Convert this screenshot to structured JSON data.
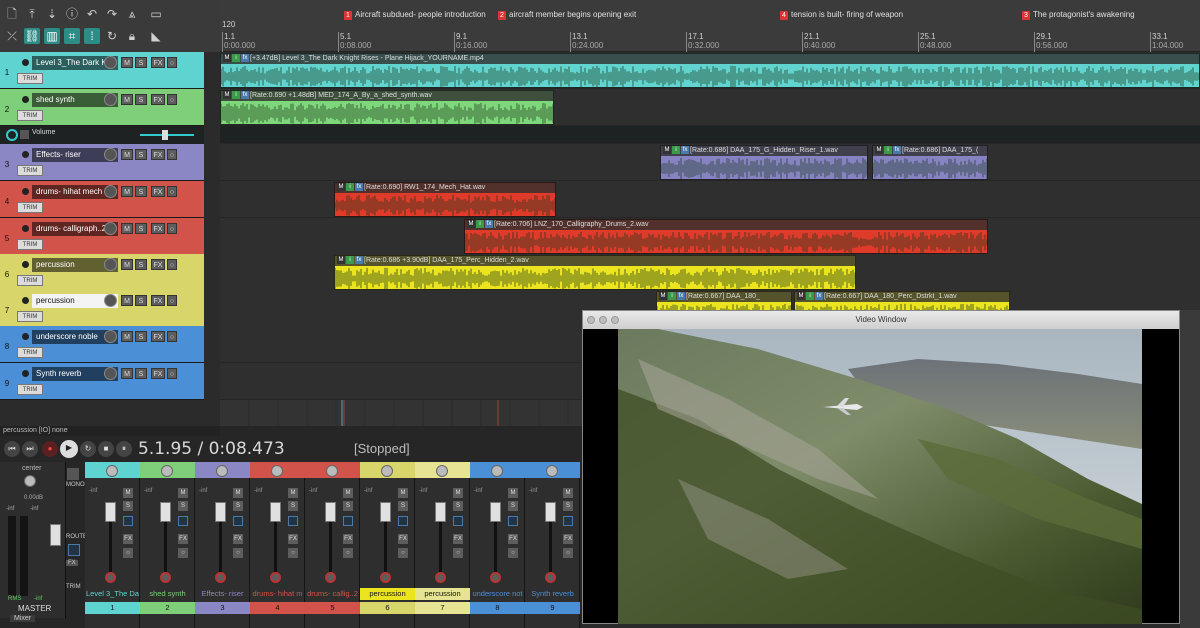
{
  "ruler": {
    "tempo": "120",
    "ticks": [
      {
        "bar": "1.1",
        "time": "0:00.000"
      },
      {
        "bar": "5.1",
        "time": "0:08.000"
      },
      {
        "bar": "9.1",
        "time": "0:16.000"
      },
      {
        "bar": "13.1",
        "time": "0:24.000"
      },
      {
        "bar": "17.1",
        "time": "0:32.000"
      },
      {
        "bar": "21.1",
        "time": "0:40.000"
      },
      {
        "bar": "25.1",
        "time": "0:48.000"
      },
      {
        "bar": "29.1",
        "time": "0:56.000"
      },
      {
        "bar": "33.1",
        "time": "1:04.000"
      }
    ],
    "markers": [
      {
        "num": "1",
        "label": "Aircraft subdued- people introduction"
      },
      {
        "num": "2",
        "label": "aircraft member begins opening exit"
      },
      {
        "num": "4",
        "label": "tension is built- firing of weapon"
      },
      {
        "num": "3",
        "label": "The protagonist's awakening"
      }
    ]
  },
  "tracks": [
    {
      "num": "1",
      "name": "Level 3_The Dark K",
      "color": "#5fd3d0",
      "light": false
    },
    {
      "num": "2",
      "name": "shed synth",
      "color": "#7fcf7a",
      "light": false
    },
    {
      "num": "3",
      "name": "Effects- riser",
      "color": "#8b87c4",
      "light": false
    },
    {
      "num": "4",
      "name": "drums- hihat mech",
      "color": "#d2534a",
      "light": false
    },
    {
      "num": "5",
      "name": "drums- calligraph..2",
      "color": "#d2534a",
      "light": false
    },
    {
      "num": "6",
      "name": "percussion",
      "color": "#d8d56a",
      "light": false
    },
    {
      "num": "7",
      "name": "percussion",
      "color": "#d8d56a",
      "light": true
    },
    {
      "num": "8",
      "name": "underscore noble",
      "color": "#4b8fd6",
      "light": false
    },
    {
      "num": "9",
      "name": "Synth reverb",
      "color": "#4b8fd6",
      "light": false
    }
  ],
  "track_buttons": {
    "mute": "M",
    "solo": "S",
    "fx": "FX",
    "trim": "TRIM"
  },
  "envelope": {
    "label": "Volume"
  },
  "items": [
    {
      "label": "[+3.47dB] Level 3_The Dark Knight Rises - Plane Hijack_YOURNAME.mp4"
    },
    {
      "label": "[Rate:0.690 +1.48dB] MED_174_A_By_a_shed_synth.wav"
    },
    {
      "label": "[Rate:0.686] DAA_175_G_Hidden_Riser_1.wav"
    },
    {
      "label": "[Rate:0.686] DAA_175_("
    },
    {
      "label": "[Rate:0.690] RW1_174_Mech_Hat.wav"
    },
    {
      "label": "[Rate:0.706] LNZ_170_Calligraphy_Drums_2.wav"
    },
    {
      "label": "[Rate:0.686 +3.90dB] DAA_175_Perc_Hidden_2.wav"
    },
    {
      "label": "[Rate:0.667] DAA_180_"
    },
    {
      "label": "[Rate:0.667] DAA_180_Perc_Dstrkt_1.wav"
    }
  ],
  "status": {
    "text": "percussion [IO] none"
  },
  "transport": {
    "timecode": "5.1.95 / 0:08.473",
    "state": "[Stopped]"
  },
  "master": {
    "center": "center",
    "level": "0.00dB",
    "peak_l": "-inf",
    "peak_r": "-inf",
    "mono": "MONO",
    "route": "ROUTE",
    "fx": "FX",
    "trim": "TRIM",
    "rms": "RMS",
    "rms_value": "-inf",
    "label": "MASTER",
    "tab": "Mixer"
  },
  "mixer": {
    "strips": [
      {
        "name": "Level 3_The Da",
        "num": "1",
        "color": "#5fd3d0",
        "peak": "-inf"
      },
      {
        "name": "shed synth",
        "num": "2",
        "color": "#7fcf7a",
        "peak": "-inf"
      },
      {
        "name": "Effects- riser",
        "num": "3",
        "color": "#8b87c4",
        "peak": "-inf"
      },
      {
        "name": "drums- hihat m",
        "num": "4",
        "color": "#d2534a",
        "peak": "-inf"
      },
      {
        "name": "drums- callig..2",
        "num": "5",
        "color": "#d2534a",
        "peak": "-inf"
      },
      {
        "name": "percussion",
        "num": "6",
        "color": "#d8d56a",
        "peak": "-inf"
      },
      {
        "name": "percussion",
        "num": "7",
        "color": "#e6e392",
        "peak": "-inf"
      },
      {
        "name": "underscore not",
        "num": "8",
        "color": "#4b8fd6",
        "peak": "-inf"
      },
      {
        "name": "Synth reverb",
        "num": "9",
        "color": "#4b8fd6",
        "peak": "-inf"
      }
    ]
  },
  "video": {
    "title": "Video Window"
  }
}
